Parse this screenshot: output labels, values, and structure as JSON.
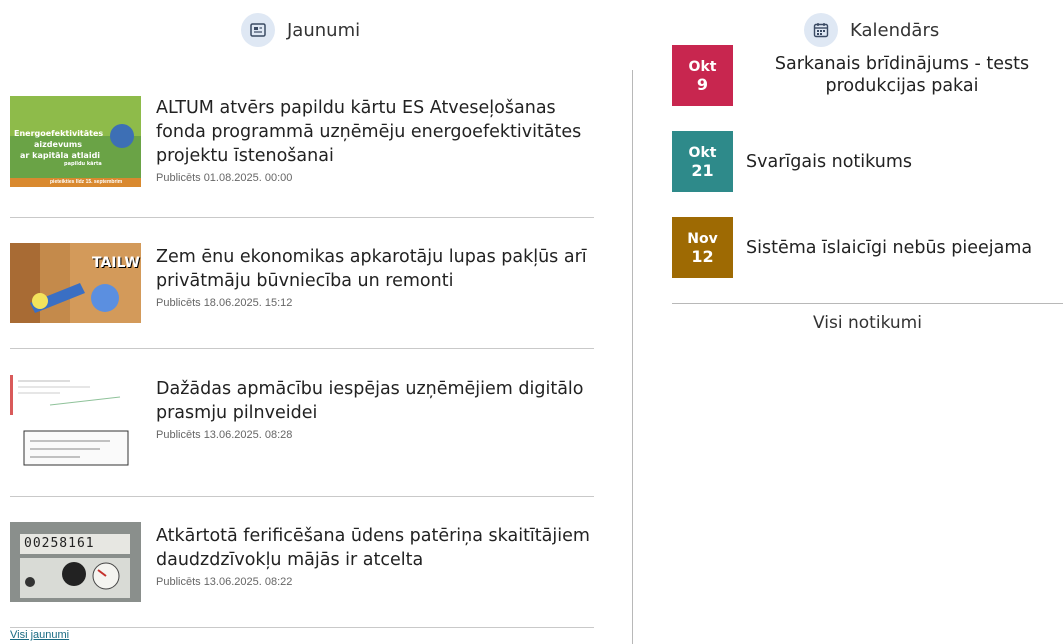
{
  "news": {
    "heading": "Jaunumi",
    "heading_icon": "newspaper-icon",
    "items": [
      {
        "title": "ALTUM atvērs papildu kārtu ES Atveseļošanas fonda programmā uzņēmēju energoefektivitātes projektu īstenošanai",
        "date": "Publicēts 01.08.2025. 00:00",
        "thumb": {
          "line1": "Energoefektivitātes",
          "line2": "aizdevums",
          "line3": "ar kapitāla atlaidi",
          "line4": "papildu kārta",
          "footer": "pieteikties līdz 15. septembrim"
        }
      },
      {
        "title": "Zem ēnu ekonomikas apkarotāju lupas pakļūs arī privātmāju būvniecība un remonti",
        "date": "Publicēts 18.06.2025. 15:12",
        "thumb": {
          "label": "TAILWIND"
        }
      },
      {
        "title": "Dažādas apmācību iespējas uzņēmējiem digitālo prasmju pilnveidei",
        "date": "Publicēts 13.06.2025. 08:28",
        "thumb": {}
      },
      {
        "title": "Atkārtotā ferificēšana ūdens patēriņa skaitītājiem daudzdzīvokļu mājās ir atcelta",
        "date": "Publicēts 13.06.2025. 08:22",
        "thumb": {
          "digits": "00258161"
        }
      }
    ],
    "all_link": "Visi jaunumi"
  },
  "calendar": {
    "heading": "Kalendārs",
    "heading_icon": "calendar-icon",
    "events": [
      {
        "month": "Okt",
        "day": "9",
        "title": "Sarkanais brīdinājums - tests produkcijas pakai",
        "color": "#c8264f"
      },
      {
        "month": "Okt",
        "day": "21",
        "title": "Svarīgais notikums",
        "color": "#2e8a8a"
      },
      {
        "month": "Nov",
        "day": "12",
        "title": "Sistēma īslaicīgi nebūs pieejama",
        "color": "#9e6a03"
      }
    ],
    "all_link": "Visi notikumi"
  }
}
